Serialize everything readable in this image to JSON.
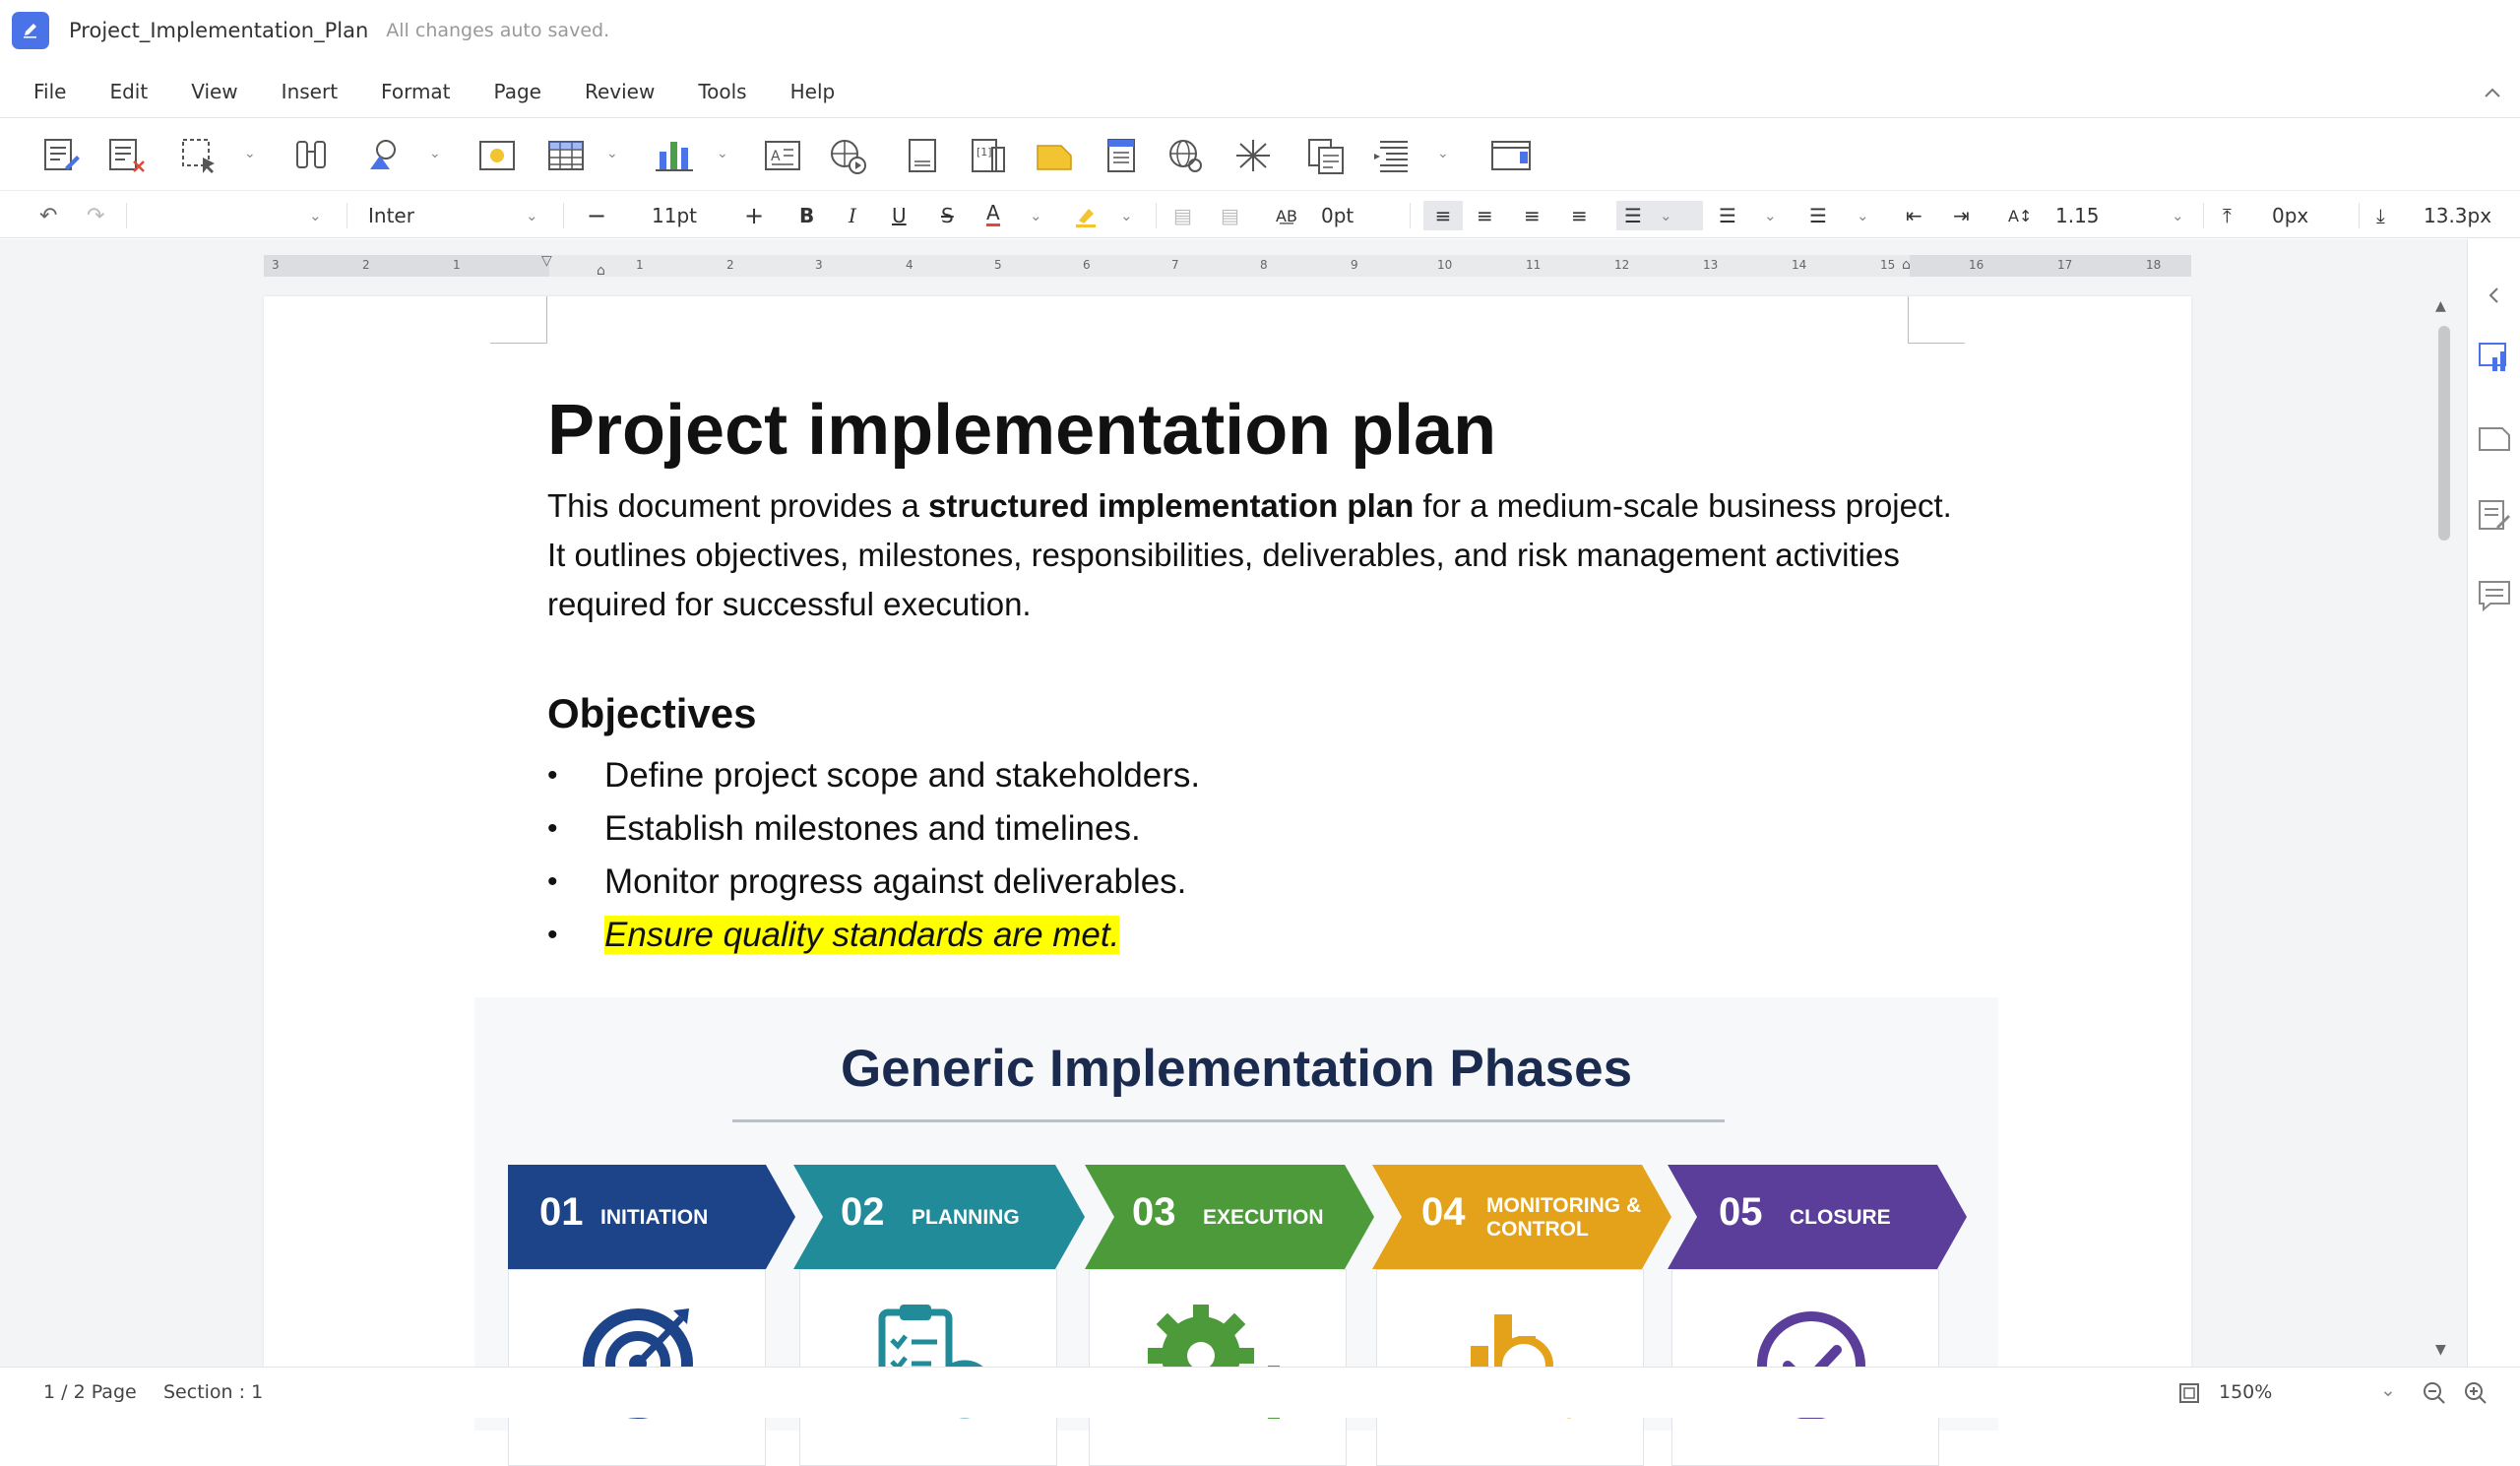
{
  "window": {
    "title": "Project_Implementation_Plan",
    "save_status": "All changes auto saved."
  },
  "menu": [
    "File",
    "Edit",
    "View",
    "Insert",
    "Format",
    "Page",
    "Review",
    "Tools",
    "Help"
  ],
  "format_bar": {
    "font": "Inter",
    "size": "11pt",
    "char_spacing": "0pt",
    "line_spacing": "1.15",
    "space_before": "0px",
    "space_after": "13.3px"
  },
  "ruler": {
    "ticks": [
      "3",
      "2",
      "1",
      "1",
      "2",
      "3",
      "4",
      "5",
      "6",
      "7",
      "8",
      "9",
      "10",
      "11",
      "12",
      "13",
      "14",
      "15",
      "16",
      "17",
      "18"
    ]
  },
  "document": {
    "title": "Project implementation plan",
    "intro_pre": "This document provides a ",
    "intro_bold": "structured implementation plan",
    "intro_post": " for a medium-scale business project. It outlines objectives, milestones, responsibilities, deliverables, and risk management activities required for successful execution.",
    "objectives_heading": "Objectives",
    "bullets": [
      "Define project scope and stakeholders.",
      "Establish milestones and timelines.",
      "Monitor progress against deliverables.",
      "Ensure quality standards are met."
    ],
    "infographic": {
      "title": "Generic Implementation Phases",
      "phases": [
        {
          "num": "01",
          "name": "INITIATION",
          "color": "#1d4489",
          "icon": "target-icon"
        },
        {
          "num": "02",
          "name": "PLANNING",
          "color": "#218b99",
          "icon": "clipboard-clock-icon"
        },
        {
          "num": "03",
          "name": "EXECUTION",
          "color": "#4c9a3a",
          "icon": "gears-icon"
        },
        {
          "num": "04",
          "name": "MONITORING & CONTROL",
          "color": "#e3a21a",
          "icon": "chart-magnifier-icon"
        },
        {
          "num": "05",
          "name": "CLOSURE",
          "color": "#5b3d9a",
          "icon": "check-circle-icon"
        }
      ]
    }
  },
  "status": {
    "page": "1 / 2 Page",
    "section": "Section : 1",
    "zoom": "150%"
  },
  "colors": {
    "accent": "#4a73e8",
    "highlight": "#ffff00"
  }
}
